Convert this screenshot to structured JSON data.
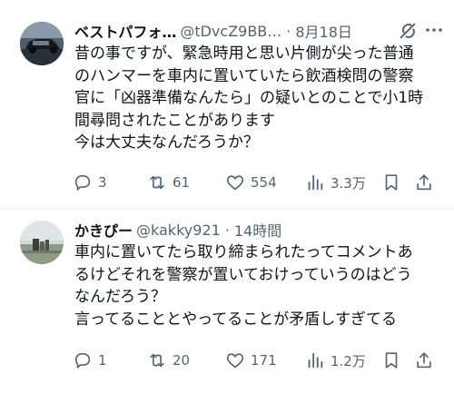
{
  "tweets": [
    {
      "display_name": "ベストパフォ…",
      "handle": "@tDvcZ9BB…",
      "separator": "·",
      "time": "8月18日",
      "body_lines": [
        "昔の事ですが、緊急時用と思い片側が尖った普通",
        "のハンマーを車内に置いていたら飲酒検問の警察",
        "官に「凶器準備なんたら」の疑いとのことで小1時",
        "間尋問されたことがあります",
        "今は大丈夫なんだろうか？"
      ],
      "replies": "3",
      "reposts": "61",
      "likes": "554",
      "views": "3.3万",
      "avatar_icon": "car-photo-avatar"
    },
    {
      "display_name": "かきぴー",
      "handle": "@kakky921",
      "separator": "·",
      "time": "14時間",
      "body_lines": [
        "車内に置いてたら取り締まられたってコメントあ",
        "るけどそれを警察が置いておけっていうのはどう",
        "なんだろう？",
        "言ってることとやってることが矛盾しすぎてる"
      ],
      "replies": "1",
      "reposts": "20",
      "likes": "171",
      "views": "1.2万",
      "avatar_icon": "landscape-photo-avatar"
    }
  ],
  "icons": {
    "reply": "reply-icon",
    "repost": "repost-icon",
    "like": "like-icon",
    "views": "views-icon",
    "bookmark": "bookmark-icon",
    "share": "share-icon",
    "grok": "grok-icon",
    "more": "more-icon"
  },
  "colors": {
    "text": "#0f1419",
    "secondary": "#536471",
    "divider": "#eff3f4"
  }
}
